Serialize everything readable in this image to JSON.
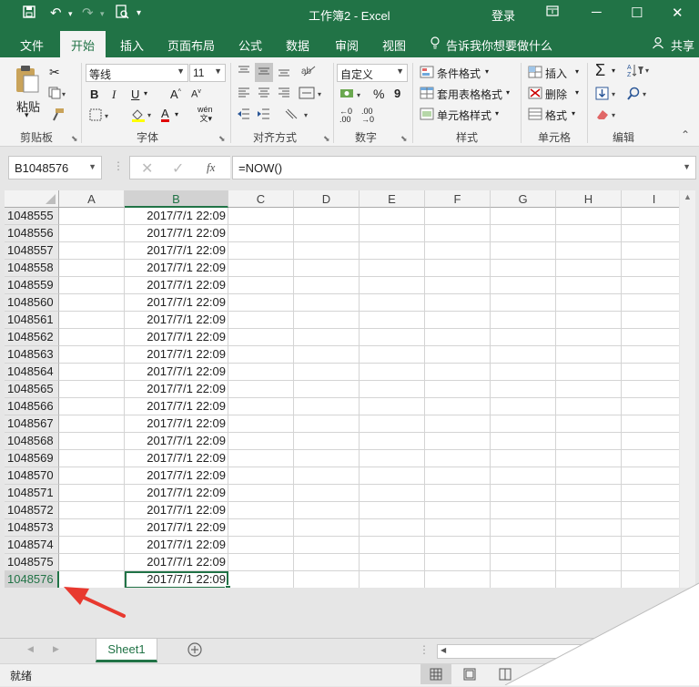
{
  "titlebar": {
    "title": "工作簿2  -  Excel",
    "login": "登录"
  },
  "tabs": [
    {
      "label": "文件"
    },
    {
      "label": "开始"
    },
    {
      "label": "插入"
    },
    {
      "label": "页面布局"
    },
    {
      "label": "公式"
    },
    {
      "label": "数据"
    },
    {
      "label": "审阅"
    },
    {
      "label": "视图"
    }
  ],
  "tell_me": "告诉我你想要做什么",
  "share": "共享",
  "ribbon": {
    "paste": "粘贴",
    "font_name": "等线",
    "font_size": "11",
    "bold": "B",
    "italic": "I",
    "underline": "U",
    "font_color": "A",
    "number_format": "自定义",
    "percent": "%",
    "comma": "9",
    "cond_format": "条件格式",
    "table_format": "套用表格格式",
    "cell_style": "单元格样式",
    "insert": "插入",
    "delete": "删除",
    "format": "格式",
    "groups": [
      "剪贴板",
      "字体",
      "对齐方式",
      "数字",
      "样式",
      "单元格",
      "编辑"
    ]
  },
  "formula_bar": {
    "name_box": "B1048576",
    "formula": "=NOW()"
  },
  "columns": [
    "A",
    "B",
    "C",
    "D",
    "E",
    "F",
    "G",
    "H",
    "I"
  ],
  "rows": [
    {
      "num": "1048555",
      "b": "2017/7/1 22:09"
    },
    {
      "num": "1048556",
      "b": "2017/7/1 22:09"
    },
    {
      "num": "1048557",
      "b": "2017/7/1 22:09"
    },
    {
      "num": "1048558",
      "b": "2017/7/1 22:09"
    },
    {
      "num": "1048559",
      "b": "2017/7/1 22:09"
    },
    {
      "num": "1048560",
      "b": "2017/7/1 22:09"
    },
    {
      "num": "1048561",
      "b": "2017/7/1 22:09"
    },
    {
      "num": "1048562",
      "b": "2017/7/1 22:09"
    },
    {
      "num": "1048563",
      "b": "2017/7/1 22:09"
    },
    {
      "num": "1048564",
      "b": "2017/7/1 22:09"
    },
    {
      "num": "1048565",
      "b": "2017/7/1 22:09"
    },
    {
      "num": "1048566",
      "b": "2017/7/1 22:09"
    },
    {
      "num": "1048567",
      "b": "2017/7/1 22:09"
    },
    {
      "num": "1048568",
      "b": "2017/7/1 22:09"
    },
    {
      "num": "1048569",
      "b": "2017/7/1 22:09"
    },
    {
      "num": "1048570",
      "b": "2017/7/1 22:09"
    },
    {
      "num": "1048571",
      "b": "2017/7/1 22:09"
    },
    {
      "num": "1048572",
      "b": "2017/7/1 22:09"
    },
    {
      "num": "1048573",
      "b": "2017/7/1 22:09"
    },
    {
      "num": "1048574",
      "b": "2017/7/1 22:09"
    },
    {
      "num": "1048575",
      "b": "2017/7/1 22:09"
    },
    {
      "num": "1048576",
      "b": "2017/7/1 22:09"
    }
  ],
  "sheet_tab": "Sheet1",
  "status": "就绪",
  "colors": {
    "accent": "#217346",
    "annotation_arrow": "#e8392f"
  }
}
